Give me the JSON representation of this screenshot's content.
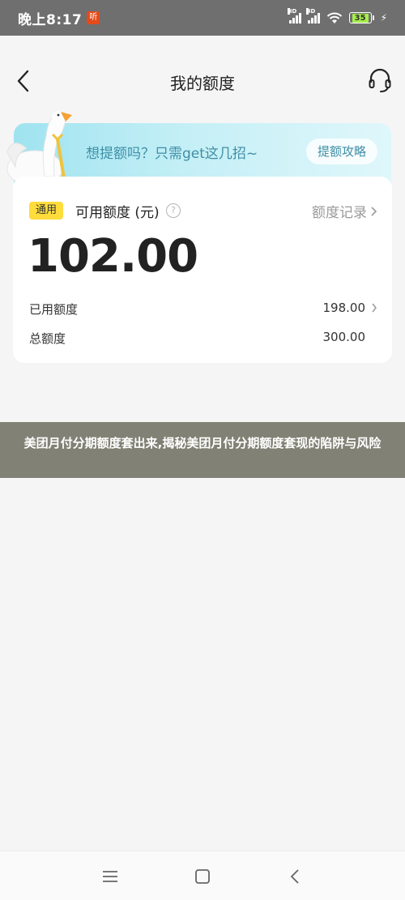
{
  "status_bar": {
    "time": "晚上8:17",
    "notification_badge": "听",
    "signal_1_label": "HD",
    "signal_2_label": "HD",
    "battery": "35"
  },
  "header": {
    "title": "我的额度"
  },
  "promo": {
    "text": "想提额吗？只需get这几招~",
    "button": "提额攻略"
  },
  "quota": {
    "tag": "通用",
    "available_label": "可用额度 (元)",
    "help_icon": "?",
    "records_link": "额度记录",
    "available_amount": "102.00",
    "used_label": "已用额度",
    "used_value": "198.00",
    "total_label": "总额度",
    "total_value": "300.00"
  },
  "article": {
    "title": "美团月付分期额度套出来,揭秘美团月付分期额度套现的陷阱与风险"
  },
  "colors": {
    "status_bar": "#6f6f6f",
    "tag_yellow": "#fedc3c",
    "promo_text": "#3f8fa6",
    "article_banner": "#818175"
  },
  "icons": {
    "back": "chevron-left-icon",
    "support": "headset-icon",
    "help": "question-circle-icon",
    "records": "chevron-right-icon",
    "nav_menu": "menu-icon",
    "nav_home": "home-square-icon",
    "nav_back": "nav-back-icon"
  }
}
